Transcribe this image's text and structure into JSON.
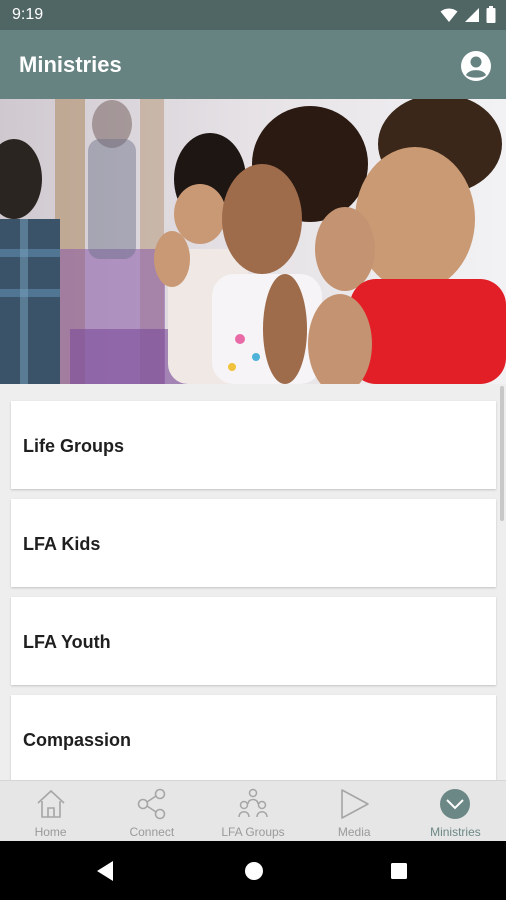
{
  "status_bar": {
    "time": "9:19"
  },
  "app_bar": {
    "title": "Ministries",
    "profile_icon": "account-circle-icon"
  },
  "hero": {
    "description_icon": "children-worship-photo"
  },
  "ministries": [
    {
      "label": "Life Groups"
    },
    {
      "label": "LFA Kids"
    },
    {
      "label": "LFA Youth"
    },
    {
      "label": "Compassion"
    }
  ],
  "bottom_nav": {
    "items": [
      {
        "label": "Home",
        "icon": "home-icon"
      },
      {
        "label": "Connect",
        "icon": "share-icon"
      },
      {
        "label": "LFA Groups",
        "icon": "group-icon"
      },
      {
        "label": "Media",
        "icon": "play-icon"
      },
      {
        "label": "Ministries",
        "icon": "chevron-down-circle-icon",
        "active": true
      }
    ]
  },
  "colors": {
    "status_bar": "#4f6664",
    "app_bar": "#668381",
    "accent": "#6c8886",
    "nav_inactive": "#9a9a9a"
  }
}
